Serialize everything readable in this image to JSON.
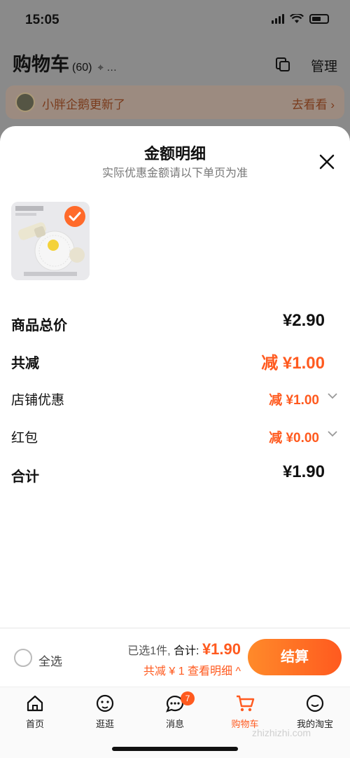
{
  "status_bar": {
    "time": "15:05"
  },
  "cart_header": {
    "title": "购物车",
    "count": "(60)",
    "location": "…",
    "manage": "管理"
  },
  "notice": {
    "text": "小胖企鹅更新了",
    "action": "去看看 ›"
  },
  "sheet": {
    "title": "金额明细",
    "subtitle": "实际优惠金额请以下单页为准",
    "product_thumb_icon": "product-image"
  },
  "breakdown": [
    {
      "label": "商品总价",
      "value": "¥2.90",
      "emphasis": "bold",
      "color": "#111111",
      "expandable": false
    },
    {
      "label": "共减",
      "value": "减 ¥1.00",
      "emphasis": "bold",
      "color": "#ff5a1f",
      "expandable": false
    },
    {
      "label": "店铺优惠",
      "value": "减 ¥1.00",
      "emphasis": "normal",
      "color": "#ff5a1f",
      "expandable": true
    },
    {
      "label": "红包",
      "value": "减 ¥0.00",
      "emphasis": "normal",
      "color": "#ff5a1f",
      "expandable": true
    },
    {
      "label": "合计",
      "value": "¥1.90",
      "emphasis": "bold",
      "color": "#111111",
      "expandable": false
    }
  ],
  "checkout_bar": {
    "select_all": "全选",
    "selected_text": "已选1件,",
    "total_label": "合计:",
    "total_amount": "¥1.90",
    "discount_link": "共减 ¥ 1  查看明细 ^",
    "checkout_label": "结算"
  },
  "tabs": [
    {
      "label": "首页",
      "icon": "home-icon"
    },
    {
      "label": "逛逛",
      "icon": "browse-icon"
    },
    {
      "label": "消息",
      "icon": "message-icon",
      "badge": "7"
    },
    {
      "label": "购物车",
      "icon": "cart-icon",
      "active": true
    },
    {
      "label": "我的淘宝",
      "icon": "profile-icon"
    }
  ],
  "colors": {
    "accent": "#ff5a1f"
  },
  "watermark": "zhizhizhi.com"
}
